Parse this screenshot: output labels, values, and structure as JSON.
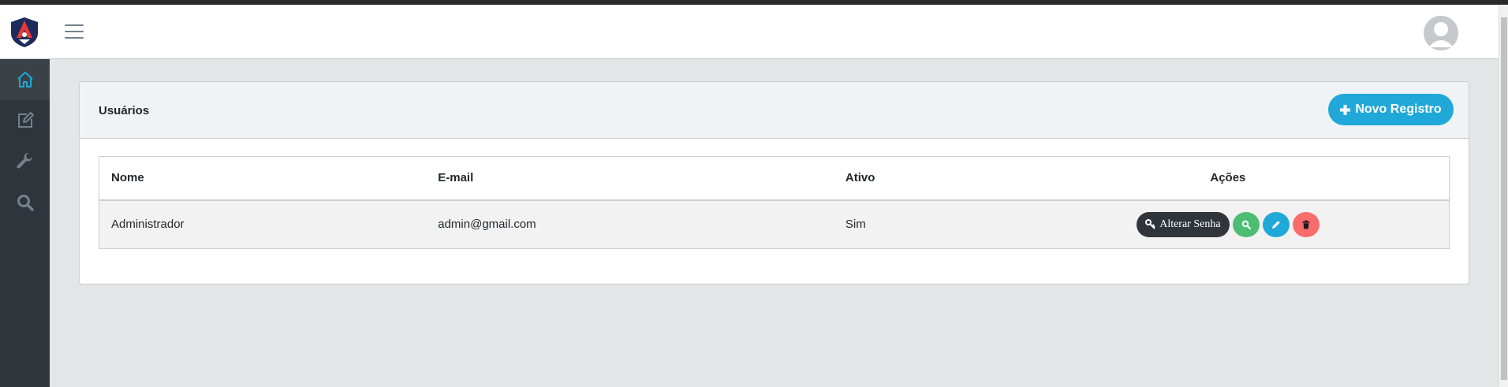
{
  "header": {
    "logo_icon": "brand-logo",
    "menu_icon": "hamburger-icon",
    "avatar_icon": "user-avatar"
  },
  "sidebar": {
    "items": [
      {
        "icon": "home-icon",
        "active": true
      },
      {
        "icon": "edit-icon",
        "active": false
      },
      {
        "icon": "wrench-icon",
        "active": false
      },
      {
        "icon": "search-icon",
        "active": false
      }
    ]
  },
  "card": {
    "title": "Usuários",
    "new_button": "Novo Registro",
    "new_button_icon": "plus-icon"
  },
  "table": {
    "columns": [
      "Nome",
      "E-mail",
      "Ativo",
      "Ações"
    ],
    "rows": [
      {
        "nome": "Administrador",
        "email": "admin@gmail.com",
        "ativo": "Sim",
        "actions": {
          "change_password": "Alterar Senha",
          "change_password_icon": "key-icon",
          "view_icon": "search-icon",
          "edit_icon": "pencil-icon",
          "delete_icon": "trash-icon"
        }
      }
    ]
  },
  "colors": {
    "primary": "#20a8d8",
    "success": "#4dbd74",
    "danger": "#f86c6b",
    "dark": "#2f353a"
  }
}
